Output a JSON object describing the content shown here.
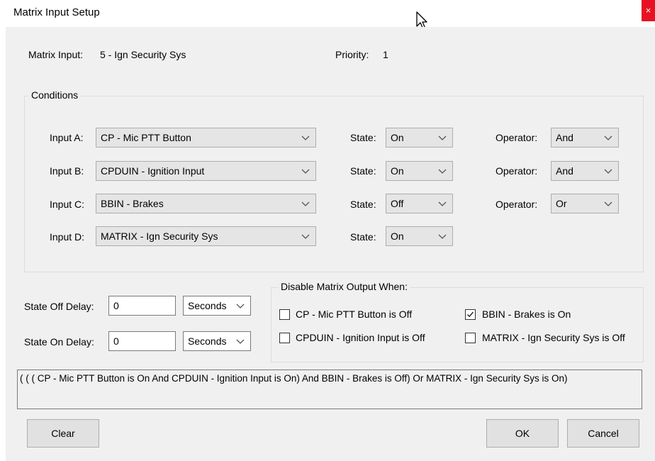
{
  "window": {
    "title": "Matrix Input Setup",
    "close_glyph": "×"
  },
  "header": {
    "matrix_input_label": "Matrix Input:",
    "matrix_input_value": "5 - Ign Security Sys",
    "priority_label": "Priority:",
    "priority_value": "1"
  },
  "conditions": {
    "legend": "Conditions",
    "state_label": "State:",
    "operator_label": "Operator:",
    "rows": [
      {
        "label": "Input A:",
        "input": "CP - Mic PTT Button",
        "state": "On",
        "operator": "And"
      },
      {
        "label": "Input B:",
        "input": "CPDUIN - Ignition Input",
        "state": "On",
        "operator": "And"
      },
      {
        "label": "Input C:",
        "input": "BBIN - Brakes",
        "state": "Off",
        "operator": "Or"
      },
      {
        "label": "Input D:",
        "input": "MATRIX - Ign Security Sys",
        "state": "On"
      }
    ]
  },
  "delays": {
    "off_label": "State Off Delay:",
    "off_value": "0",
    "off_unit": "Seconds",
    "on_label": "State On Delay:",
    "on_value": "0",
    "on_unit": "Seconds"
  },
  "disable": {
    "legend": "Disable Matrix Output When:",
    "items": [
      {
        "label": "CP - Mic PTT Button is Off",
        "checked": false
      },
      {
        "label": "BBIN - Brakes is On",
        "checked": true
      },
      {
        "label": "CPDUIN - Ignition Input is Off",
        "checked": false
      },
      {
        "label": "MATRIX - Ign Security Sys is Off",
        "checked": false
      }
    ]
  },
  "summary": {
    "text": "( ( ( CP - Mic PTT Button is On And CPDUIN - Ignition Input is On) And BBIN - Brakes is Off) Or MATRIX - Ign Security Sys is On)"
  },
  "buttons": {
    "clear": "Clear",
    "ok": "OK",
    "cancel": "Cancel"
  },
  "icons": {
    "dropdown": "chevron-down-icon",
    "cursor": "mouse-pointer-icon",
    "check": "check-icon",
    "close": "close-icon"
  },
  "colors": {
    "close_button": "#e81123",
    "dialog_background": "#f0f0f0",
    "combo_background": "#e5e5e5"
  }
}
